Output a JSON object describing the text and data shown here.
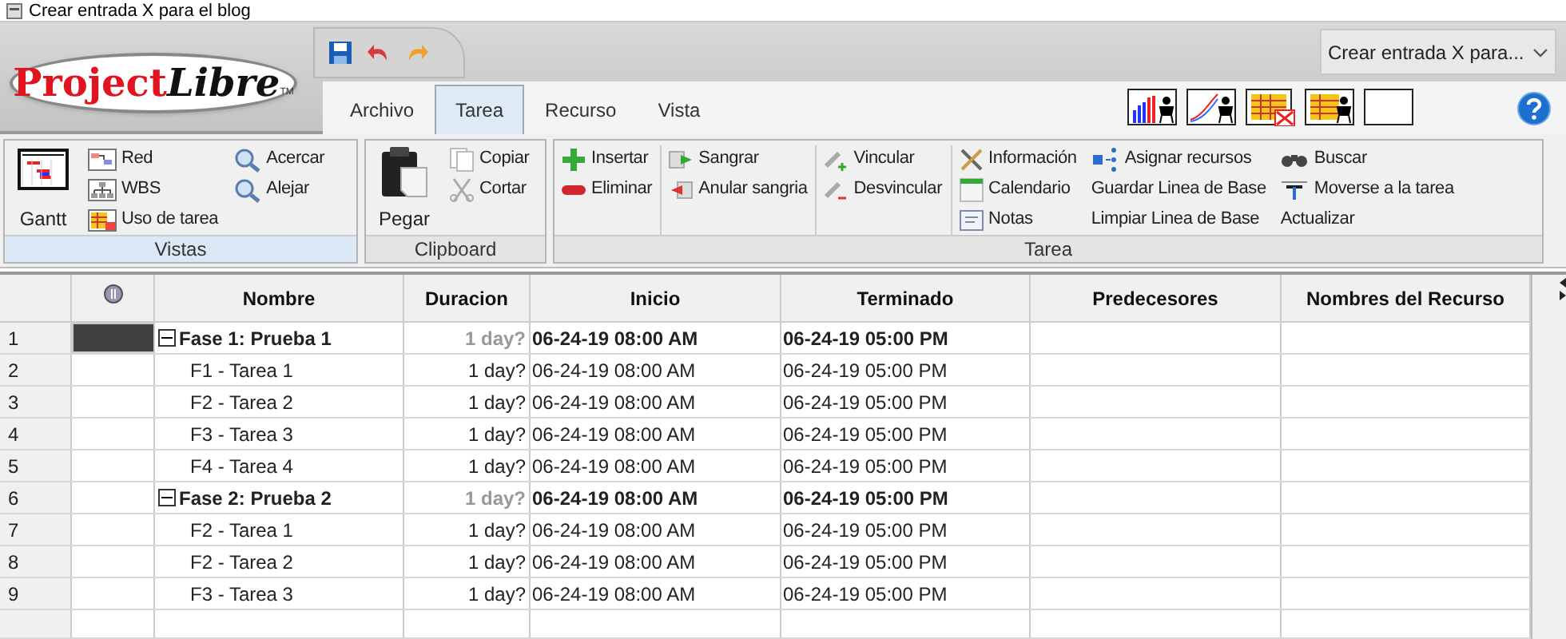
{
  "window": {
    "title": "Crear entrada X para el blog"
  },
  "logo": {
    "first": "Project",
    "second": "Libre",
    "mark": "TM"
  },
  "tabs": [
    {
      "label": "Archivo",
      "selected": false
    },
    {
      "label": "Tarea",
      "selected": true
    },
    {
      "label": "Recurso",
      "selected": false
    },
    {
      "label": "Vista",
      "selected": false
    }
  ],
  "project_dropdown": {
    "value": "Crear entrada X para..."
  },
  "ribbon": {
    "groups": [
      {
        "label": "Vistas",
        "columns": [
          {
            "kind": "large",
            "items": [
              {
                "label": "Gantt"
              }
            ]
          },
          {
            "kind": "small",
            "items": [
              {
                "label": "Red"
              },
              {
                "label": "WBS"
              },
              {
                "label": "Uso de tarea"
              }
            ]
          },
          {
            "kind": "small",
            "items": [
              {
                "label": "Acercar"
              },
              {
                "label": "Alejar"
              }
            ]
          }
        ]
      },
      {
        "label": "Clipboard",
        "columns": [
          {
            "kind": "large",
            "items": [
              {
                "label": "Pegar"
              }
            ]
          },
          {
            "kind": "small",
            "items": [
              {
                "label": "Copiar"
              },
              {
                "label": "Cortar"
              }
            ]
          }
        ]
      },
      {
        "label": "Tarea",
        "columns": [
          {
            "kind": "small",
            "items": [
              {
                "label": "Insertar"
              },
              {
                "label": "Eliminar"
              }
            ]
          },
          {
            "kind": "small",
            "items": [
              {
                "label": "Sangrar"
              },
              {
                "label": "Anular sangria"
              }
            ]
          },
          {
            "kind": "small",
            "items": [
              {
                "label": "Vincular"
              },
              {
                "label": "Desvincular"
              }
            ]
          },
          {
            "kind": "small",
            "items": [
              {
                "label": "Información"
              },
              {
                "label": "Calendario"
              },
              {
                "label": "Notas"
              }
            ]
          },
          {
            "kind": "small",
            "items": [
              {
                "label": "Asignar recursos"
              },
              {
                "label": "Guardar Linea de Base"
              },
              {
                "label": "Limpiar Linea de Base"
              }
            ]
          },
          {
            "kind": "small",
            "items": [
              {
                "label": "Buscar"
              },
              {
                "label": "Moverse a la tarea"
              },
              {
                "label": "Actualizar"
              }
            ]
          }
        ]
      }
    ]
  },
  "table": {
    "columns": [
      "Nombre",
      "Duracion",
      "Inicio",
      "Terminado",
      "Predecesores",
      "Nombres del Recurso"
    ],
    "rows": [
      {
        "number": "1",
        "name": "Fase 1: Prueba 1",
        "duration": "1 day?",
        "start": "06-24-19 08:00 AM",
        "finish": "06-24-19 05:00 PM",
        "selected": true,
        "expanded": true,
        "children": [
          {
            "number": "2",
            "name": "F1 - Tarea 1",
            "duration": "1 day?",
            "start": "06-24-19 08:00 AM",
            "finish": "06-24-19 05:00 PM",
            "selected": false
          },
          {
            "number": "3",
            "name": "F2 - Tarea 2",
            "duration": "1 day?",
            "start": "06-24-19 08:00 AM",
            "finish": "06-24-19 05:00 PM",
            "selected": false
          },
          {
            "number": "4",
            "name": "F3 - Tarea 3",
            "duration": "1 day?",
            "start": "06-24-19 08:00 AM",
            "finish": "06-24-19 05:00 PM",
            "selected": false
          },
          {
            "number": "5",
            "name": "F4 - Tarea 4",
            "duration": "1 day?",
            "start": "06-24-19 08:00 AM",
            "finish": "06-24-19 05:00 PM",
            "selected": false
          }
        ]
      },
      {
        "number": "6",
        "name": "Fase 2: Prueba 2",
        "duration": "1 day?",
        "start": "06-24-19 08:00 AM",
        "finish": "06-24-19 05:00 PM",
        "selected": false,
        "expanded": true,
        "children": [
          {
            "number": "7",
            "name": "F2 - Tarea 1",
            "duration": "1 day?",
            "start": "06-24-19 08:00 AM",
            "finish": "06-24-19 05:00 PM",
            "selected": false
          },
          {
            "number": "8",
            "name": "F2 - Tarea 2",
            "duration": "1 day?",
            "start": "06-24-19 08:00 AM",
            "finish": "06-24-19 05:00 PM",
            "selected": false
          },
          {
            "number": "9",
            "name": "F3 - Tarea 3",
            "duration": "1 day?",
            "start": "06-24-19 08:00 AM",
            "finish": "06-24-19 05:00 PM",
            "selected": false
          }
        ]
      }
    ]
  }
}
